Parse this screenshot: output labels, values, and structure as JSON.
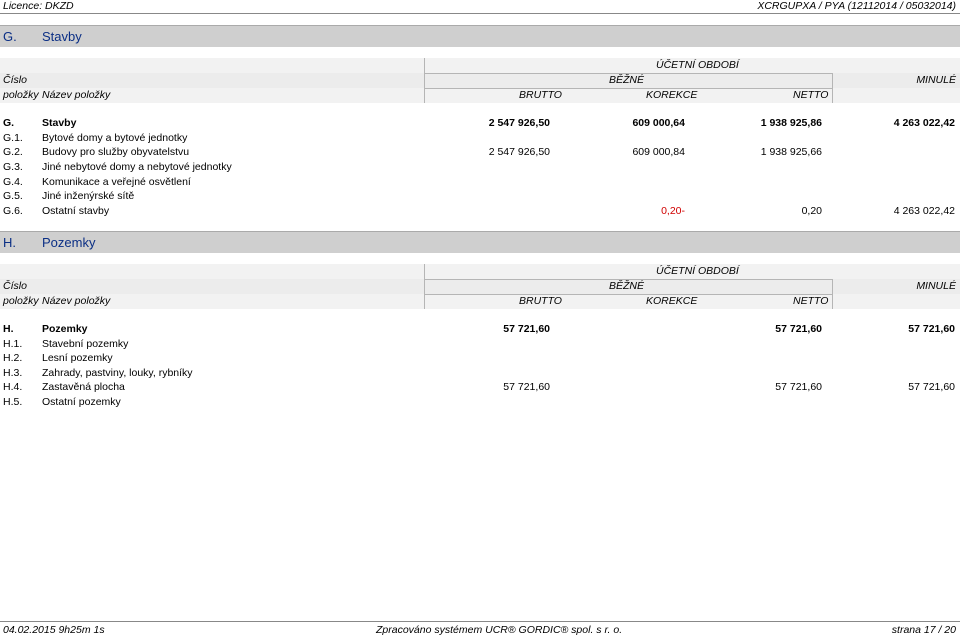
{
  "header": {
    "licence": "Licence: DKZD",
    "report_id": "XCRGUPXA / PYA  (12112014 / 05032014)"
  },
  "columns": {
    "cislo": "Číslo",
    "polozky": "položky",
    "nazev": "Název položky",
    "ucetni_obdobi": "ÚČETNÍ OBDOBÍ",
    "bezne": "BĚŽNÉ",
    "minule": "MINULÉ",
    "brutto": "BRUTTO",
    "korekce": "KOREKCE",
    "netto": "NETTO"
  },
  "sections": [
    {
      "code": "G.",
      "title": "Stavby",
      "rows": [
        {
          "code": "G.",
          "name": "Stavby",
          "brutto": "2 547 926,50",
          "korekce": "609 000,64",
          "netto": "1 938 925,86",
          "minule": "4 263 022,42",
          "bold": true
        },
        {
          "code": "G.1.",
          "name": "Bytové domy a bytové jednotky",
          "brutto": "",
          "korekce": "",
          "netto": "",
          "minule": ""
        },
        {
          "code": "G.2.",
          "name": "Budovy pro služby obyvatelstvu",
          "brutto": "2 547 926,50",
          "korekce": "609 000,84",
          "netto": "1 938 925,66",
          "minule": ""
        },
        {
          "code": "G.3.",
          "name": "Jiné nebytové domy a nebytové jednotky",
          "brutto": "",
          "korekce": "",
          "netto": "",
          "minule": ""
        },
        {
          "code": "G.4.",
          "name": "Komunikace a veřejné osvětlení",
          "brutto": "",
          "korekce": "",
          "netto": "",
          "minule": ""
        },
        {
          "code": "G.5.",
          "name": "Jiné inženýrské sítě",
          "brutto": "",
          "korekce": "",
          "netto": "",
          "minule": ""
        },
        {
          "code": "G.6.",
          "name": "Ostatní stavby",
          "brutto": "",
          "korekce": "0,20-",
          "netto": "0,20",
          "minule": "4 263 022,42",
          "korekce_red": true
        }
      ]
    },
    {
      "code": "H.",
      "title": "Pozemky",
      "rows": [
        {
          "code": "H.",
          "name": "Pozemky",
          "brutto": "57 721,60",
          "korekce": "",
          "netto": "57 721,60",
          "minule": "57 721,60",
          "bold": true
        },
        {
          "code": "H.1.",
          "name": "Stavební pozemky",
          "brutto": "",
          "korekce": "",
          "netto": "",
          "minule": ""
        },
        {
          "code": "H.2.",
          "name": "Lesní pozemky",
          "brutto": "",
          "korekce": "",
          "netto": "",
          "minule": ""
        },
        {
          "code": "H.3.",
          "name": "Zahrady, pastviny, louky, rybníky",
          "brutto": "",
          "korekce": "",
          "netto": "",
          "minule": ""
        },
        {
          "code": "H.4.",
          "name": "Zastavěná plocha",
          "brutto": "57 721,60",
          "korekce": "",
          "netto": "57 721,60",
          "minule": "57 721,60"
        },
        {
          "code": "H.5.",
          "name": "Ostatní pozemky",
          "brutto": "",
          "korekce": "",
          "netto": "",
          "minule": ""
        }
      ]
    }
  ],
  "footer": {
    "date": "04.02.2015 9h25m 1s",
    "processed": "Zpracováno systémem UCR® GORDIC® spol. s  r. o.",
    "page": "strana 17 / 20"
  }
}
